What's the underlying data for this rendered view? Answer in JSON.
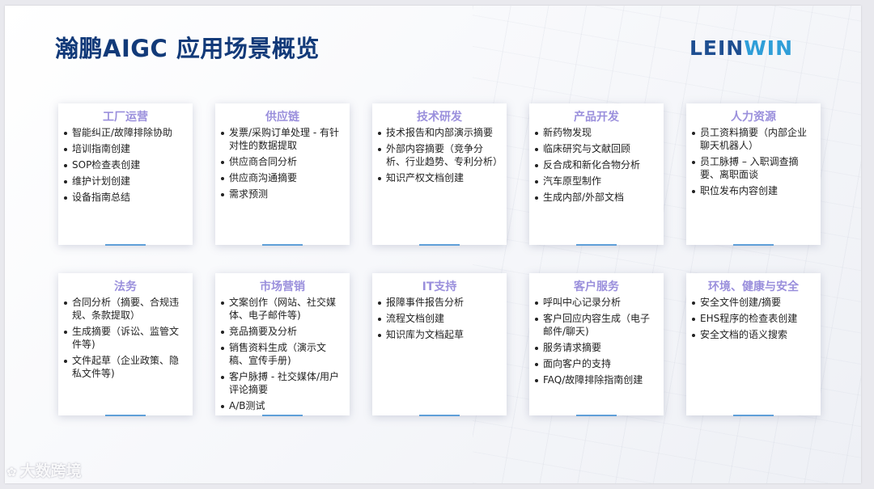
{
  "title": "瀚鹏AIGC 应用场景概览",
  "logo": {
    "part1": "LEIN",
    "part2": "WIN"
  },
  "cards": [
    {
      "title": "工厂运营",
      "items": [
        "智能纠正/故障排除协助",
        "培训指南创建",
        "SOP检查表创建",
        "维护计划创建",
        "设备指南总结"
      ]
    },
    {
      "title": "供应链",
      "items": [
        "发票/采购订单处理 - 有针对性的数据提取",
        "供应商合同分析",
        "供应商沟通摘要",
        "需求预测"
      ]
    },
    {
      "title": "技术研发",
      "items": [
        "技术报告和内部演示摘要",
        "外部内容摘要（竞争分析、行业趋势、专利分析）",
        "知识产权文档创建"
      ]
    },
    {
      "title": "产品开发",
      "items": [
        "新药物发现",
        "临床研究与文献回顾",
        "反合成和新化合物分析",
        "汽车原型制作",
        "生成内部/外部文档"
      ]
    },
    {
      "title": "人力资源",
      "items": [
        "员工资料摘要（内部企业聊天机器人）",
        "员工脉搏 – 入职调查摘要、离职面谈",
        "职位发布内容创建"
      ]
    },
    {
      "title": "法务",
      "items": [
        "合同分析（摘要、合规违规、条款提取）",
        "生成摘要（诉讼、监管文件等)",
        "文件起草（企业政策、隐私文件等)"
      ]
    },
    {
      "title": "市场营销",
      "items": [
        "文案创作（网站、社交媒体、电子邮件等)",
        "竞品摘要及分析",
        "销售资料生成（演示文稿、宣传手册)",
        "客户脉搏 - 社交媒体/用户评论摘要",
        "A/B测试"
      ]
    },
    {
      "title": "IT支持",
      "items": [
        "报障事件报告分析",
        "流程文档创建",
        "知识库为文档起草"
      ]
    },
    {
      "title": "客户服务",
      "items": [
        "呼叫中心记录分析",
        "客户回应内容生成（电子邮件/聊天)",
        "服务请求摘要",
        "面向客户的支持",
        "FAQ/故障排除指南创建"
      ]
    },
    {
      "title": "环境、健康与安全",
      "items": [
        "安全文件创建/摘要",
        "EHS程序的检查表创建",
        "安全文档的语义搜索"
      ]
    }
  ],
  "watermark": "大数跨境"
}
